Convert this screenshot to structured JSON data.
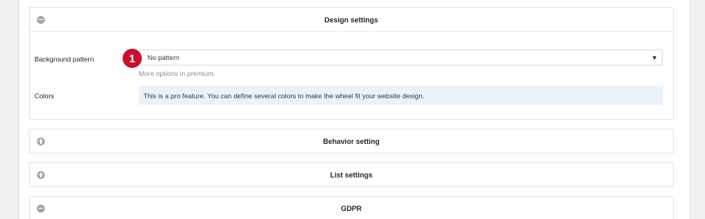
{
  "panels": [
    {
      "title": "Design settings",
      "expanded": true,
      "toggle_icon": "collapse-icon",
      "fields": {
        "background_pattern": {
          "label": "Background pattern",
          "step_number": "1",
          "value": "No pattern",
          "hint": "More options in premium."
        },
        "colors": {
          "label": "Colors",
          "info": "This is a pro feature. You can define several colors to make the wheel fit your website design."
        }
      }
    },
    {
      "title": "Behavior setting",
      "expanded": false,
      "toggle_icon": "expand-icon"
    },
    {
      "title": "List settings",
      "expanded": false,
      "toggle_icon": "expand-icon"
    },
    {
      "title": "GDPR",
      "expanded": true,
      "toggle_icon": "collapse-icon"
    }
  ],
  "colors": {
    "page_background": "#f1f1f1",
    "toggle_icon": "#a0a5aa",
    "step_badge": "#c8102e",
    "info_background": "#eaf2fa",
    "hint_text": "#8c9096"
  }
}
